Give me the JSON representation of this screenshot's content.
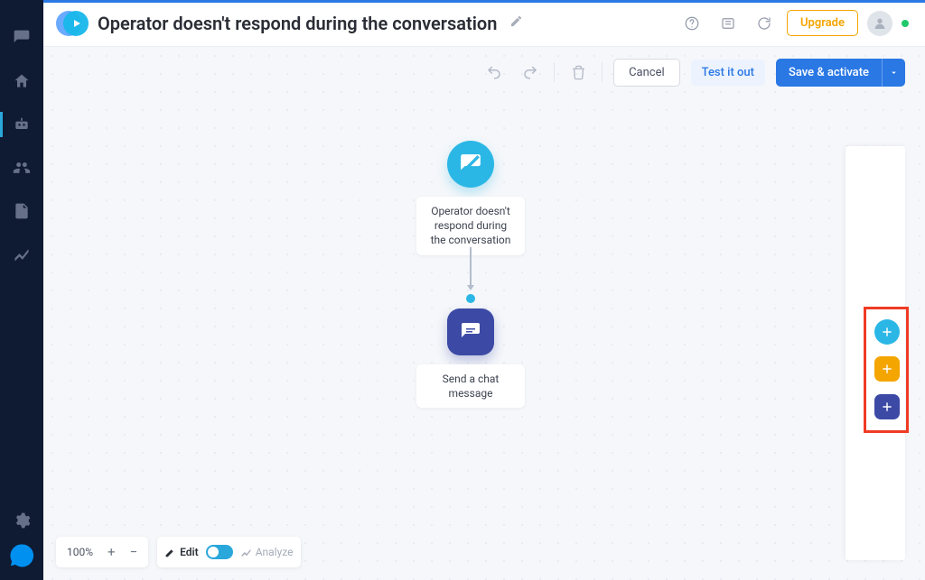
{
  "header": {
    "title": "Operator doesn't respond during the conversation",
    "upgrade_label": "Upgrade"
  },
  "toolbar": {
    "cancel_label": "Cancel",
    "test_label": "Test it out",
    "save_label": "Save & activate"
  },
  "flow": {
    "trigger": {
      "label": "Operator doesn't respond during the conversation"
    },
    "action": {
      "label": "Send a chat message"
    }
  },
  "bottom": {
    "zoom": "100%",
    "edit_label": "Edit",
    "analyze_label": "Analyze"
  },
  "sidebar": {
    "items": [
      "chat",
      "home",
      "bot",
      "contacts",
      "content",
      "analytics"
    ]
  },
  "right_panel": {
    "add_buttons": [
      "trigger",
      "condition",
      "action"
    ]
  },
  "colors": {
    "accent_blue": "#2a78e4",
    "trigger_teal": "#2bb7e5",
    "action_indigo": "#3c4aa5",
    "condition_amber": "#f4a500",
    "highlight_red": "#ef3b24"
  }
}
